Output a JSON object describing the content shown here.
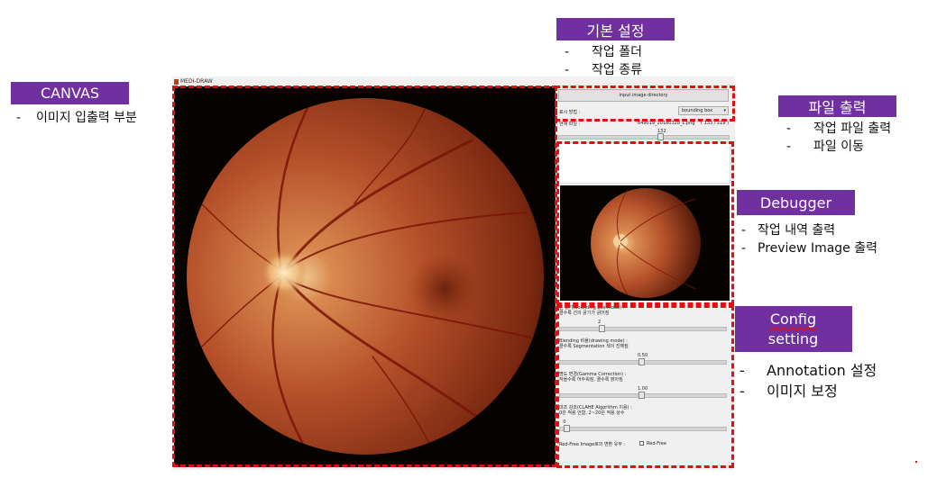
{
  "labels": {
    "canvas": {
      "title": "CANVAS",
      "bullets": [
        "이미지 입출력 부분"
      ]
    },
    "basic": {
      "title": "기본 설정",
      "bullets": [
        "작업 폴더",
        "작업 종류"
      ]
    },
    "file_output": {
      "title": "파일 출력",
      "bullets": [
        "작업 파일 출력",
        "파일 이동"
      ]
    },
    "debugger": {
      "title": "Debugger",
      "bullets": [
        "작업 내역 출력",
        "Preview Image 출력"
      ]
    },
    "config": {
      "title_line1": "Config",
      "title_line2": "setting",
      "bullets": [
        "Annotation 설정",
        "이미지 보정"
      ]
    },
    "dash": "-"
  },
  "app": {
    "title": "MEDI-DRAW",
    "input_button": "input image directory",
    "display_mode_label": "표시 방법 :",
    "display_mode_value": "bounding box",
    "current_file_label": "현재 파일 :",
    "current_file_value": "649019_20180328_L.png",
    "file_counter": "( 133 / 219 )",
    "file_slider_value": "132",
    "file_slider_fraction": 0.6,
    "settings": [
      {
        "line1": "선 굵기(bounding box mode) :",
        "line2": "클수록 선의 굵기가 굵어짐",
        "value": "2",
        "fraction": 0.25
      },
      {
        "line1": "Blending 비율(drawing mode) :",
        "line2": "클수록 Segmentation 색이 진해짐",
        "value": "0.50",
        "fraction": 0.5
      },
      {
        "line1": "명도 변경(Gamma Correction) :",
        "line2": "작을수록 어두워짐, 클수록 밝아짐",
        "value": "1.00",
        "fraction": 0.5
      },
      {
        "line1": "대조 강조(CLAHE Algorithm 이용) :",
        "line2": "0은 적용 안함, 2~20은 적용 상수",
        "value": "0",
        "fraction": 0.03
      }
    ],
    "redfree_label": "Red-Free Image로의 변환 유무 :",
    "redfree_checkbox": "Red-Free"
  },
  "colors": {
    "tag_bg": "#7030a0",
    "dash_border": "#e01010"
  }
}
